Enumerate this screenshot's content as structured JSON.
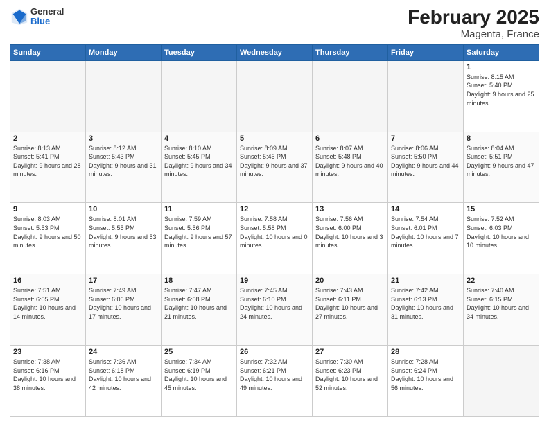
{
  "header": {
    "logo_general": "General",
    "logo_blue": "Blue",
    "title": "February 2025",
    "subtitle": "Magenta, France"
  },
  "weekdays": [
    "Sunday",
    "Monday",
    "Tuesday",
    "Wednesday",
    "Thursday",
    "Friday",
    "Saturday"
  ],
  "weeks": [
    [
      {
        "day": "",
        "info": ""
      },
      {
        "day": "",
        "info": ""
      },
      {
        "day": "",
        "info": ""
      },
      {
        "day": "",
        "info": ""
      },
      {
        "day": "",
        "info": ""
      },
      {
        "day": "",
        "info": ""
      },
      {
        "day": "1",
        "info": "Sunrise: 8:15 AM\nSunset: 5:40 PM\nDaylight: 9 hours and 25 minutes."
      }
    ],
    [
      {
        "day": "2",
        "info": "Sunrise: 8:13 AM\nSunset: 5:41 PM\nDaylight: 9 hours and 28 minutes."
      },
      {
        "day": "3",
        "info": "Sunrise: 8:12 AM\nSunset: 5:43 PM\nDaylight: 9 hours and 31 minutes."
      },
      {
        "day": "4",
        "info": "Sunrise: 8:10 AM\nSunset: 5:45 PM\nDaylight: 9 hours and 34 minutes."
      },
      {
        "day": "5",
        "info": "Sunrise: 8:09 AM\nSunset: 5:46 PM\nDaylight: 9 hours and 37 minutes."
      },
      {
        "day": "6",
        "info": "Sunrise: 8:07 AM\nSunset: 5:48 PM\nDaylight: 9 hours and 40 minutes."
      },
      {
        "day": "7",
        "info": "Sunrise: 8:06 AM\nSunset: 5:50 PM\nDaylight: 9 hours and 44 minutes."
      },
      {
        "day": "8",
        "info": "Sunrise: 8:04 AM\nSunset: 5:51 PM\nDaylight: 9 hours and 47 minutes."
      }
    ],
    [
      {
        "day": "9",
        "info": "Sunrise: 8:03 AM\nSunset: 5:53 PM\nDaylight: 9 hours and 50 minutes."
      },
      {
        "day": "10",
        "info": "Sunrise: 8:01 AM\nSunset: 5:55 PM\nDaylight: 9 hours and 53 minutes."
      },
      {
        "day": "11",
        "info": "Sunrise: 7:59 AM\nSunset: 5:56 PM\nDaylight: 9 hours and 57 minutes."
      },
      {
        "day": "12",
        "info": "Sunrise: 7:58 AM\nSunset: 5:58 PM\nDaylight: 10 hours and 0 minutes."
      },
      {
        "day": "13",
        "info": "Sunrise: 7:56 AM\nSunset: 6:00 PM\nDaylight: 10 hours and 3 minutes."
      },
      {
        "day": "14",
        "info": "Sunrise: 7:54 AM\nSunset: 6:01 PM\nDaylight: 10 hours and 7 minutes."
      },
      {
        "day": "15",
        "info": "Sunrise: 7:52 AM\nSunset: 6:03 PM\nDaylight: 10 hours and 10 minutes."
      }
    ],
    [
      {
        "day": "16",
        "info": "Sunrise: 7:51 AM\nSunset: 6:05 PM\nDaylight: 10 hours and 14 minutes."
      },
      {
        "day": "17",
        "info": "Sunrise: 7:49 AM\nSunset: 6:06 PM\nDaylight: 10 hours and 17 minutes."
      },
      {
        "day": "18",
        "info": "Sunrise: 7:47 AM\nSunset: 6:08 PM\nDaylight: 10 hours and 21 minutes."
      },
      {
        "day": "19",
        "info": "Sunrise: 7:45 AM\nSunset: 6:10 PM\nDaylight: 10 hours and 24 minutes."
      },
      {
        "day": "20",
        "info": "Sunrise: 7:43 AM\nSunset: 6:11 PM\nDaylight: 10 hours and 27 minutes."
      },
      {
        "day": "21",
        "info": "Sunrise: 7:42 AM\nSunset: 6:13 PM\nDaylight: 10 hours and 31 minutes."
      },
      {
        "day": "22",
        "info": "Sunrise: 7:40 AM\nSunset: 6:15 PM\nDaylight: 10 hours and 34 minutes."
      }
    ],
    [
      {
        "day": "23",
        "info": "Sunrise: 7:38 AM\nSunset: 6:16 PM\nDaylight: 10 hours and 38 minutes."
      },
      {
        "day": "24",
        "info": "Sunrise: 7:36 AM\nSunset: 6:18 PM\nDaylight: 10 hours and 42 minutes."
      },
      {
        "day": "25",
        "info": "Sunrise: 7:34 AM\nSunset: 6:19 PM\nDaylight: 10 hours and 45 minutes."
      },
      {
        "day": "26",
        "info": "Sunrise: 7:32 AM\nSunset: 6:21 PM\nDaylight: 10 hours and 49 minutes."
      },
      {
        "day": "27",
        "info": "Sunrise: 7:30 AM\nSunset: 6:23 PM\nDaylight: 10 hours and 52 minutes."
      },
      {
        "day": "28",
        "info": "Sunrise: 7:28 AM\nSunset: 6:24 PM\nDaylight: 10 hours and 56 minutes."
      },
      {
        "day": "",
        "info": ""
      }
    ]
  ]
}
